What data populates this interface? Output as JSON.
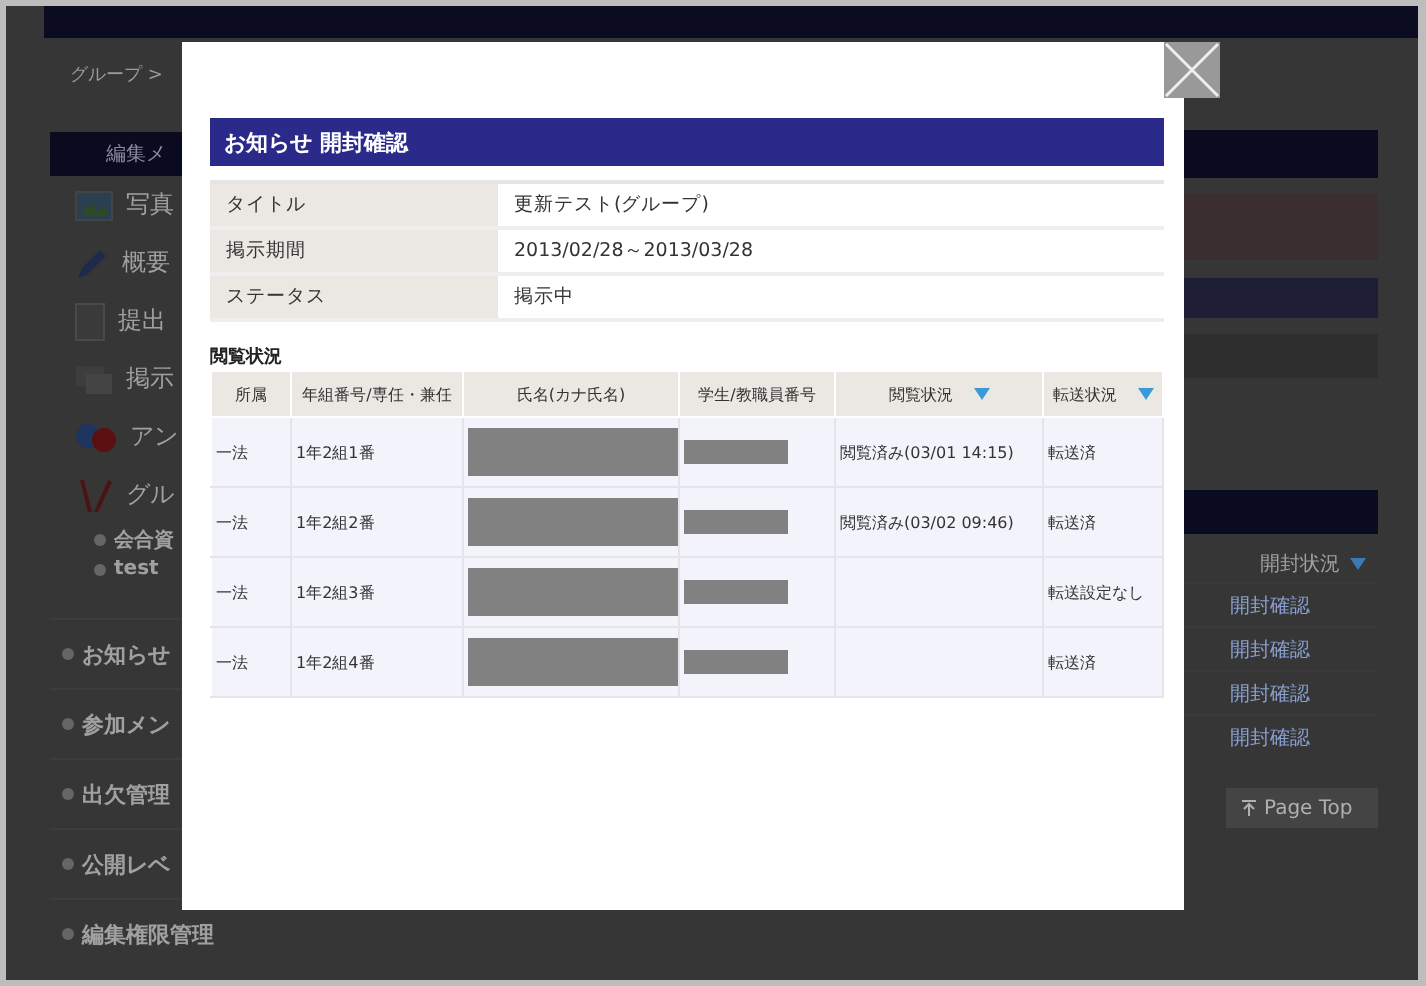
{
  "breadcrumb": "グループ >",
  "sidebar": {
    "title": "編集メ",
    "items": [
      {
        "label": "写真",
        "kind": "photo"
      },
      {
        "label": "概要",
        "kind": "pencil"
      },
      {
        "label": "提出",
        "kind": "document"
      },
      {
        "label": "掲示",
        "kind": "board"
      },
      {
        "label": "アン",
        "kind": "survey"
      },
      {
        "label": "グル",
        "kind": "group",
        "children": [
          {
            "label": "会合資"
          },
          {
            "label": "test"
          }
        ]
      }
    ],
    "links": [
      "お知らせ",
      "参加メン",
      "出欠管理",
      "公開レベ",
      "編集権限管理"
    ]
  },
  "right_panel": {
    "column_header": "開封状況",
    "links": [
      "開封確認",
      "開封確認",
      "開封確認",
      "開封確認"
    ],
    "page_top": "Page Top"
  },
  "modal": {
    "title": "お知らせ 開封確認",
    "info": [
      {
        "label": "タイトル",
        "value": "更新テスト(グループ)"
      },
      {
        "label": "掲示期間",
        "value": "2013/02/28～2013/03/28"
      },
      {
        "label": "ステータス",
        "value": "掲示中"
      }
    ],
    "section": "閲覧状況",
    "columns": [
      {
        "label": "所属",
        "sortable": false
      },
      {
        "label": "年組番号/専任・兼任",
        "sortable": false
      },
      {
        "label": "氏名(カナ氏名)",
        "sortable": false
      },
      {
        "label": "学生/教職員番号",
        "sortable": false
      },
      {
        "label": "閲覧状況",
        "sortable": true
      },
      {
        "label": "転送状況",
        "sortable": true
      }
    ],
    "rows": [
      {
        "affiliation": "一法",
        "class_number": "1年2組1番",
        "read_status": "閲覧済み(03/01 14:15)",
        "forward_status": "転送済"
      },
      {
        "affiliation": "一法",
        "class_number": "1年2組2番",
        "read_status": "閲覧済み(03/02 09:46)",
        "forward_status": "転送済"
      },
      {
        "affiliation": "一法",
        "class_number": "1年2組3番",
        "forward_status": "転送設定なし"
      },
      {
        "affiliation": "一法",
        "class_number": "1年2組4番",
        "forward_status": "転送済"
      }
    ]
  }
}
